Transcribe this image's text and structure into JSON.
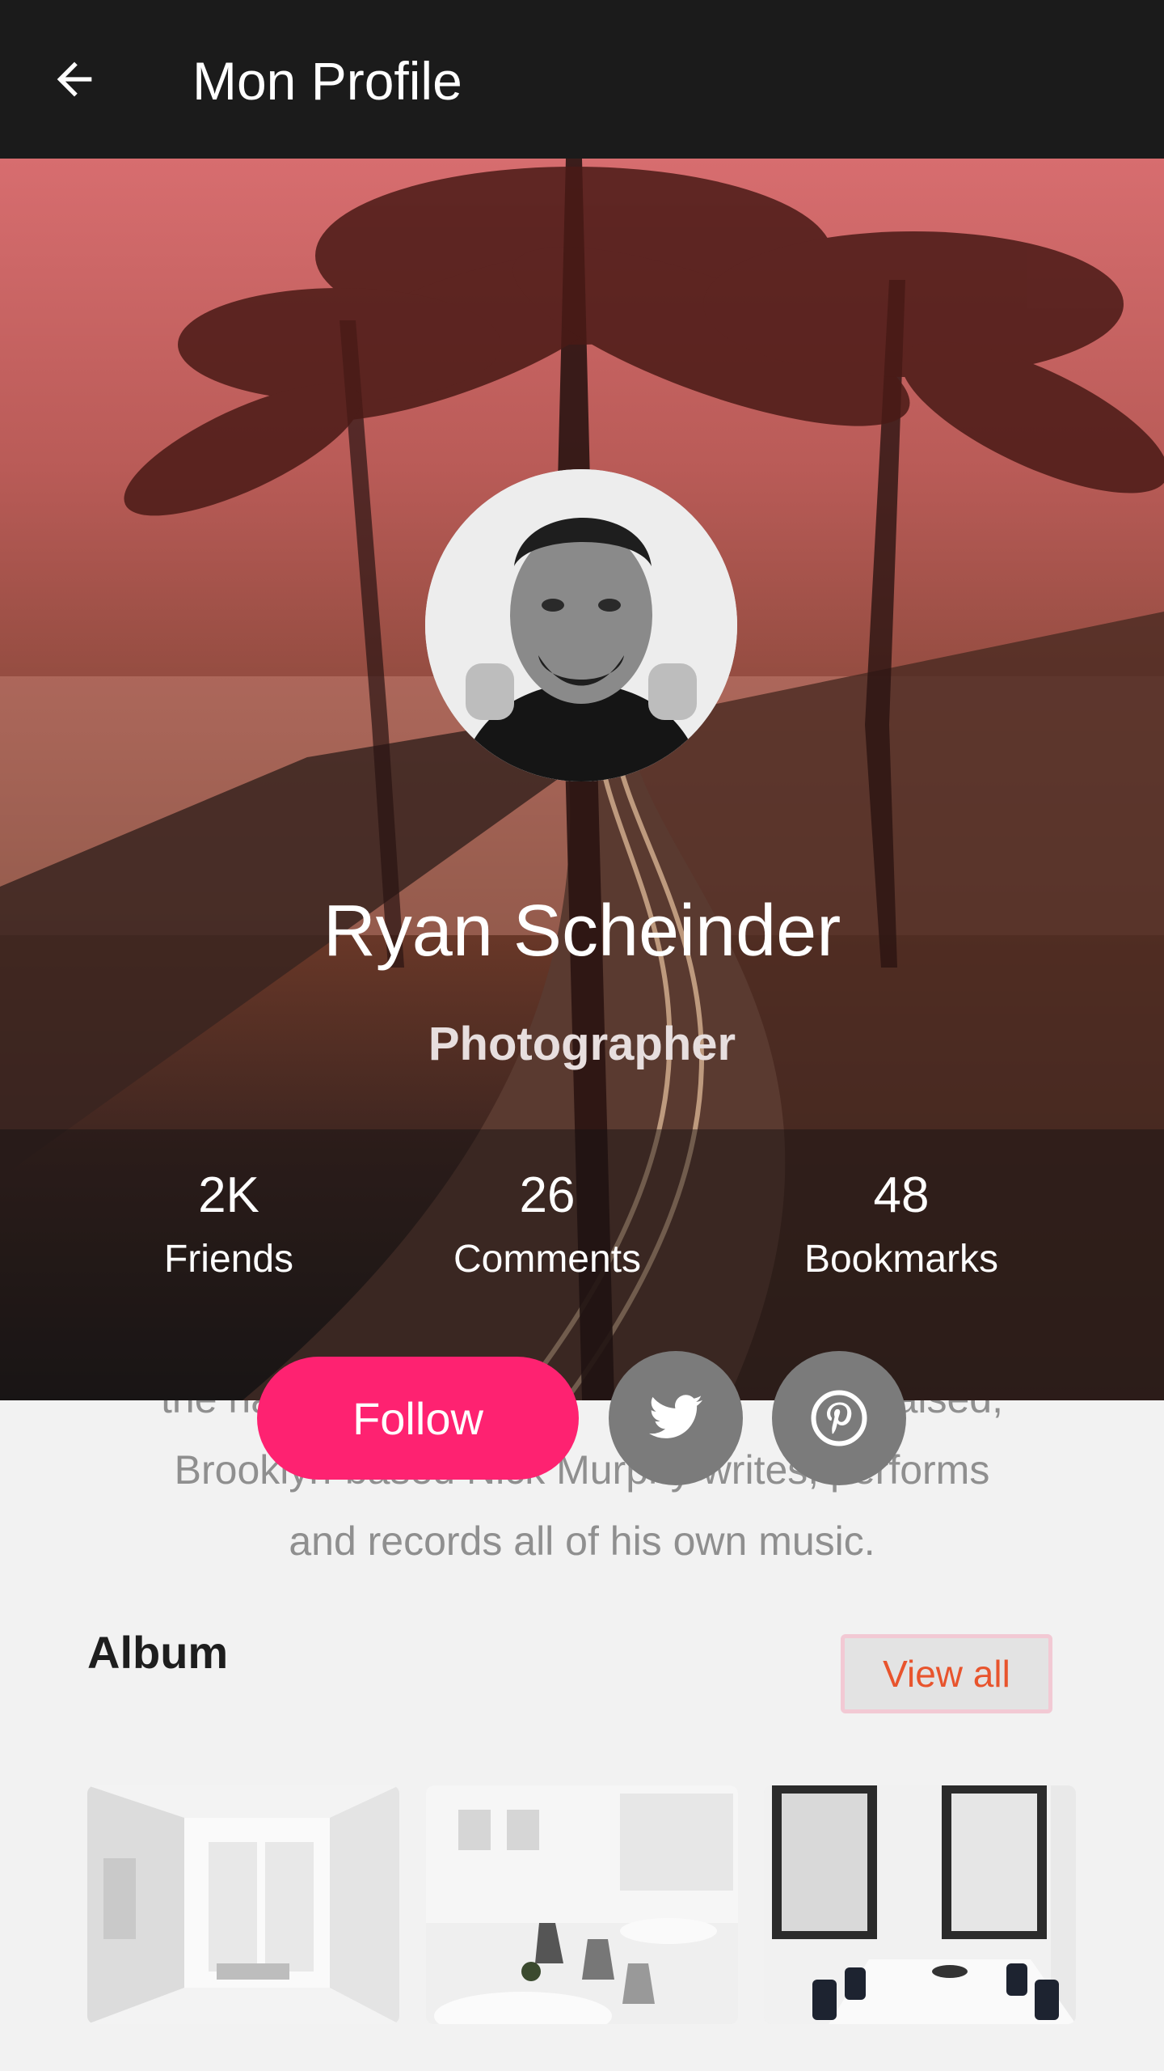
{
  "header": {
    "title": "Mon Profile",
    "back_icon": "arrow-left-icon"
  },
  "profile": {
    "name": "Ryan Scheinder",
    "role": "Photographer",
    "stats": [
      {
        "value": "2K",
        "label": "Friends"
      },
      {
        "value": "26",
        "label": "Comments"
      },
      {
        "value": "48",
        "label": "Bookmarks"
      }
    ]
  },
  "bio": {
    "lines": [
      "the ha                                 r                    raised,",
      "Brooklyn-based Nick Murphy  writes, performs",
      "and records all of his own music."
    ]
  },
  "actions": {
    "follow_label": "Follow",
    "twitter_icon": "twitter-icon",
    "pinterest_icon": "pinterest-icon"
  },
  "album": {
    "title": "Album",
    "view_all_label": "View all",
    "thumbnails": [
      "white-loft-photo",
      "white-cafe-photo",
      "meeting-room-photo"
    ]
  },
  "colors": {
    "appbar": "#1b1b1b",
    "accent": "#fe2271",
    "link": "#e8542d",
    "social_button": "#7b7b7b"
  }
}
